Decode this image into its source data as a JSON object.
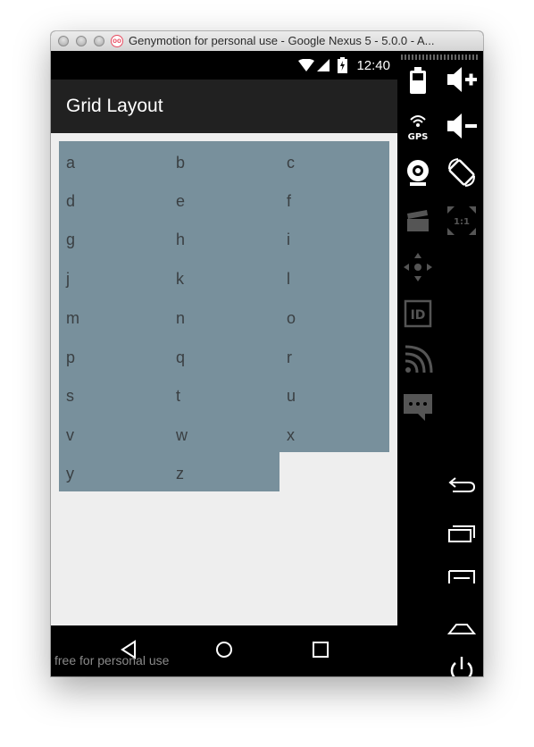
{
  "window": {
    "title": "Genymotion for personal use - Google Nexus 5 - 5.0.0 - A..."
  },
  "status_bar": {
    "time": "12:40"
  },
  "action_bar": {
    "title": "Grid Layout"
  },
  "grid": {
    "background_color": "#78909c",
    "cells": [
      "a",
      "b",
      "c",
      "d",
      "e",
      "f",
      "g",
      "h",
      "i",
      "j",
      "k",
      "l",
      "m",
      "n",
      "o",
      "p",
      "q",
      "r",
      "s",
      "t",
      "u",
      "v",
      "w",
      "x",
      "y",
      "z"
    ]
  },
  "watermark": "free for personal use",
  "sidebar_icons": [
    "battery-icon",
    "volume-up-icon",
    "gps-icon",
    "volume-down-icon",
    "camera-icon",
    "rotate-icon",
    "video-capture-icon",
    "scale-icon",
    "dpad-icon",
    "device-id-icon",
    "network-icon",
    "sms-icon",
    "back-button-icon",
    "recent-apps-icon",
    "menu-icon",
    "home-button-icon",
    "power-icon"
  ]
}
